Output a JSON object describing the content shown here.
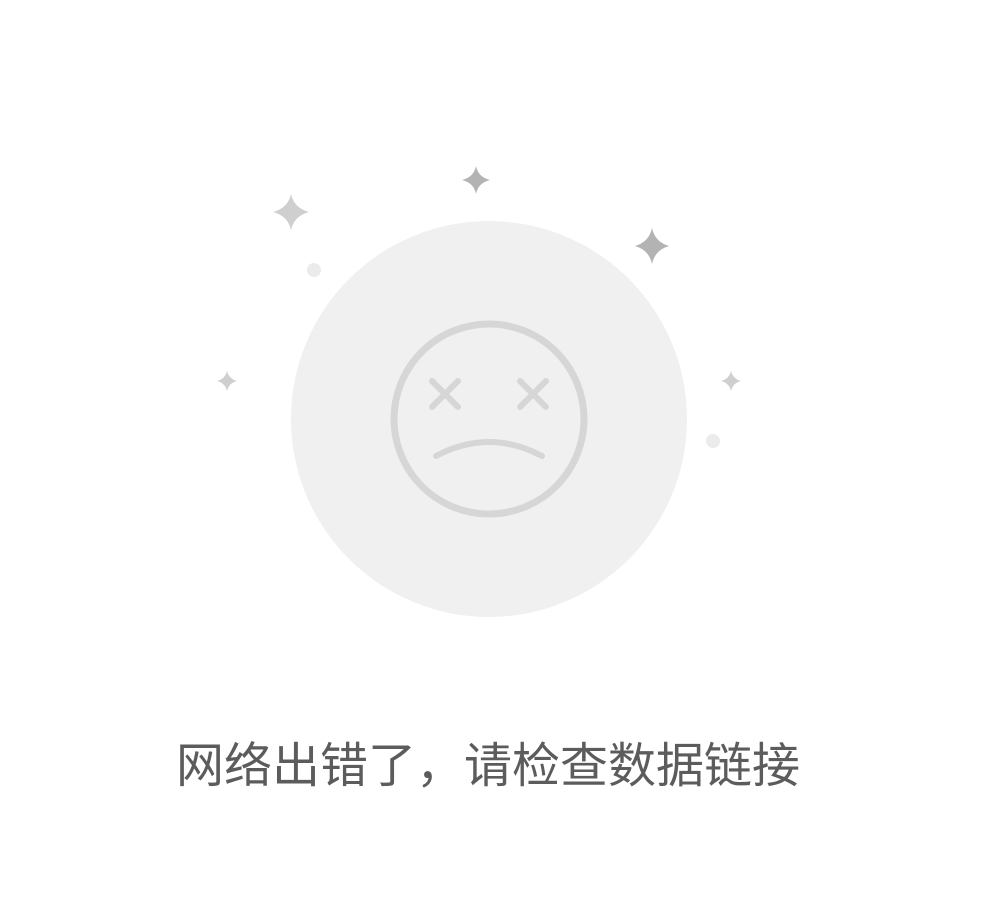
{
  "empty_state": {
    "message": "网络出错了，请检查数据链接",
    "illustration_icon": "sad-face-dead-eyes-icon",
    "sparkle_icon": "sparkle-icon"
  },
  "colors": {
    "background": "#ffffff",
    "circle_fill": "#f0f0f0",
    "face_stroke": "#d6d6d6",
    "sparkle_dark": "#b3b3b3",
    "sparkle_light": "#cfcfcf",
    "dot": "#ebebeb",
    "text": "#5c5c5c"
  }
}
